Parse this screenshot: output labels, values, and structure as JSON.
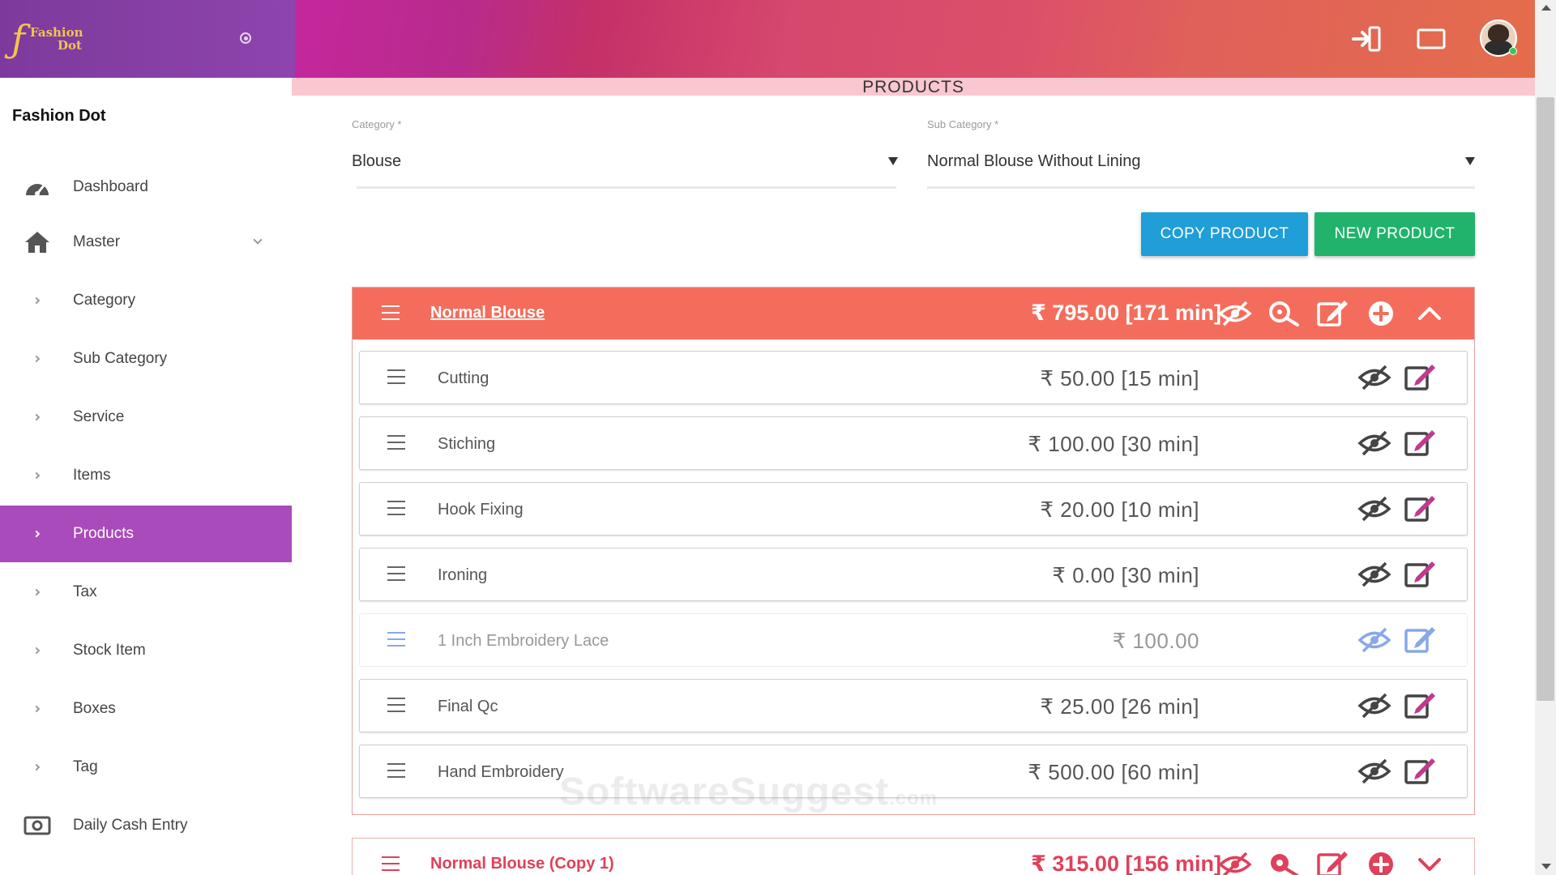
{
  "app": {
    "brand": "Fashion Dot",
    "logo_line1": "Fashion",
    "logo_line2": "Dot",
    "logo_mark": "ƒ"
  },
  "page": {
    "title": "PRODUCTS"
  },
  "colors": {
    "accent": "#a94bba",
    "group_header": "#f46d5c",
    "copy_button": "#1f9ed8",
    "new_button": "#21b36b"
  },
  "sidebar": {
    "items": [
      {
        "label": "Dashboard",
        "icon": "dashboard-icon",
        "active": false
      },
      {
        "label": "Master",
        "icon": "home-icon",
        "active": false,
        "expandable": true
      },
      {
        "label": "Category",
        "icon": "bullet-icon",
        "active": false
      },
      {
        "label": "Sub Category",
        "icon": "bullet-icon",
        "active": false
      },
      {
        "label": "Service",
        "icon": "bullet-icon",
        "active": false
      },
      {
        "label": "Items",
        "icon": "bullet-icon",
        "active": false
      },
      {
        "label": "Products",
        "icon": "bullet-icon",
        "active": true
      },
      {
        "label": "Tax",
        "icon": "bullet-icon",
        "active": false
      },
      {
        "label": "Stock Item",
        "icon": "bullet-icon",
        "active": false
      },
      {
        "label": "Boxes",
        "icon": "bullet-icon",
        "active": false
      },
      {
        "label": "Tag",
        "icon": "bullet-icon",
        "active": false
      },
      {
        "label": "Daily Cash Entry",
        "icon": "cash-icon",
        "active": false
      }
    ]
  },
  "filters": {
    "category": {
      "label": "Category *",
      "value": "Blouse"
    },
    "sub_category": {
      "label": "Sub Category *",
      "value": "Normal Blouse Without Lining"
    }
  },
  "actions": {
    "copy_label": "COPY PRODUCT",
    "new_label": "NEW PRODUCT"
  },
  "products": [
    {
      "name": "Normal Blouse",
      "price": "₹ 795.00 [171 min]",
      "services": [
        {
          "name": "Cutting",
          "price": "₹ 50.00 [15 min]",
          "faded": false
        },
        {
          "name": "Stiching",
          "price": "₹ 100.00 [30 min]",
          "faded": false
        },
        {
          "name": "Hook Fixing",
          "price": "₹ 20.00 [10 min]",
          "faded": false
        },
        {
          "name": "Ironing",
          "price": "₹ 0.00 [30 min]",
          "faded": false
        },
        {
          "name": "1 Inch Embroidery Lace",
          "price": "₹ 100.00",
          "faded": true
        },
        {
          "name": "Final Qc",
          "price": "₹ 25.00 [26 min]",
          "faded": false
        },
        {
          "name": "Hand Embroidery",
          "price": "₹ 500.00 [60 min]",
          "faded": false
        }
      ]
    },
    {
      "name": "Normal Blouse (Copy 1)",
      "price": "₹ 315.00 [156 min]"
    }
  ],
  "watermark": {
    "main": "SoftwareSuggest",
    "suffix": ".com"
  }
}
